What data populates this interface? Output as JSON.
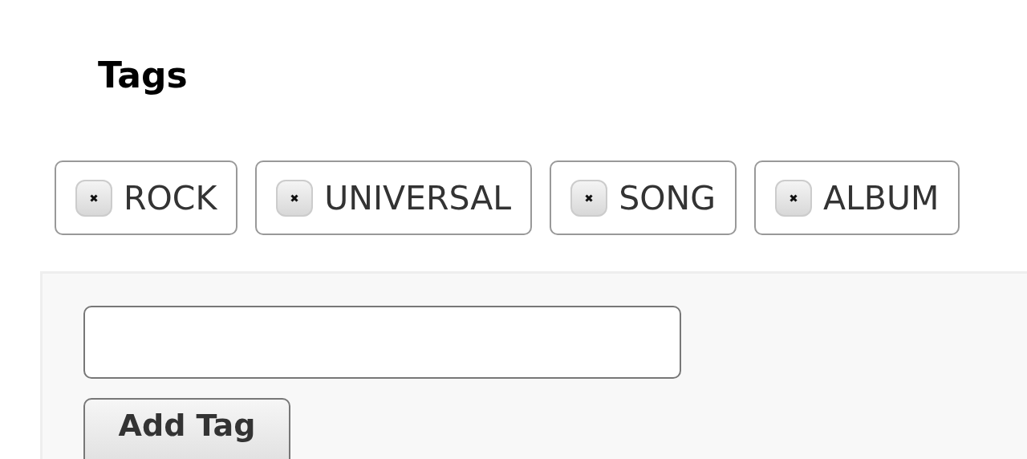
{
  "title": "Tags",
  "tags": [
    {
      "label": "ROCK"
    },
    {
      "label": "UNIVERSAL"
    },
    {
      "label": "SONG"
    },
    {
      "label": "ALBUM"
    }
  ],
  "form": {
    "button": "Add Tag"
  }
}
